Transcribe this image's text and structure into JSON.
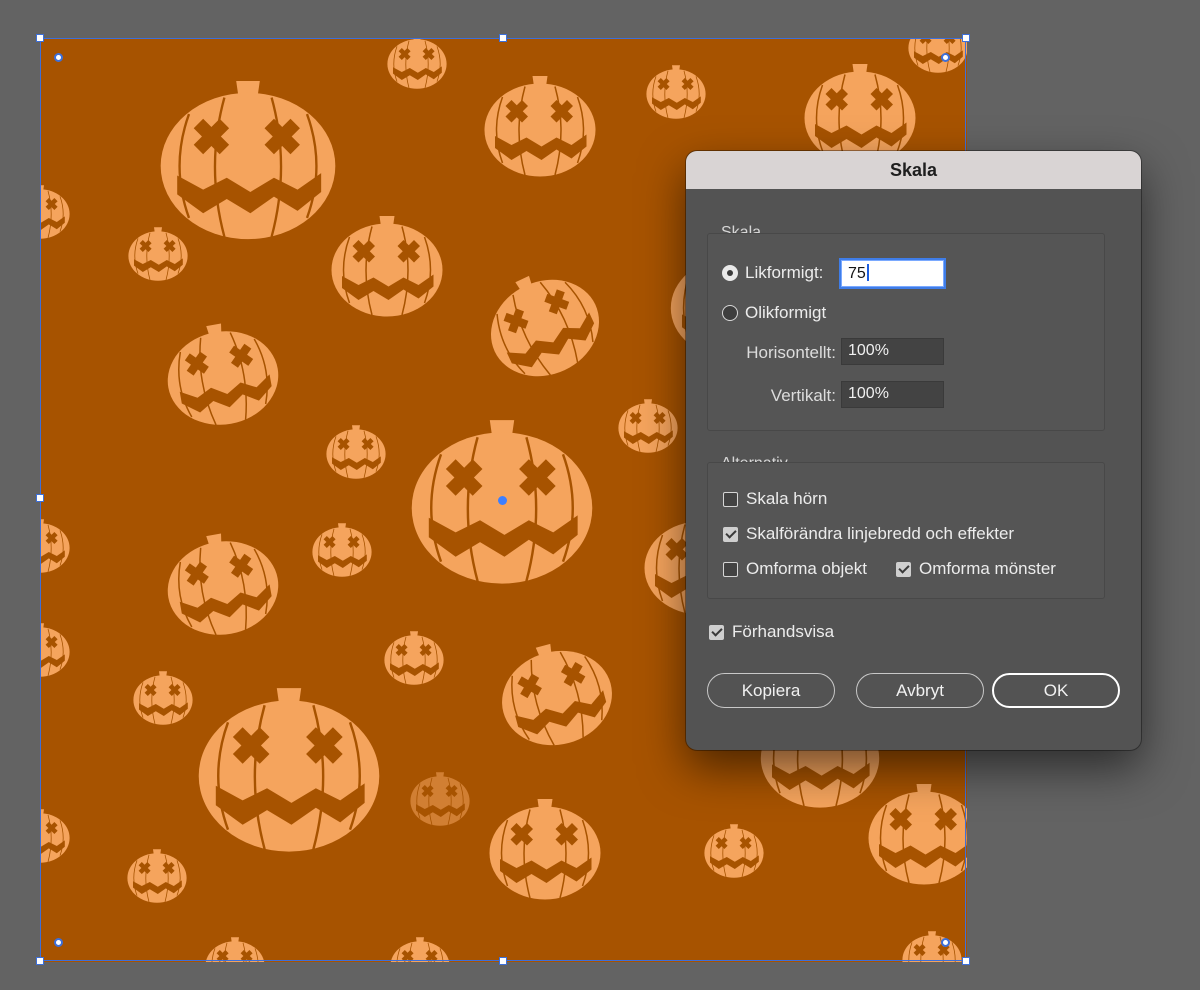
{
  "canvas": {
    "background": "#a75300",
    "pumpkin_color": "#f5a45d",
    "carve_color": "#a75300"
  },
  "dialog": {
    "title": "Skala",
    "scale_group": {
      "title": "Skala",
      "uniform_label": "Likformigt:",
      "uniform_value": "75",
      "non_uniform_label": "Olikformigt",
      "horizontal_label": "Horisontellt:",
      "horizontal_value": "100%",
      "vertical_label": "Vertikalt:",
      "vertical_value": "100%",
      "selected": "uniform"
    },
    "options_group": {
      "title": "Alternativ",
      "scale_corners": {
        "label": "Skala hörn",
        "checked": false
      },
      "scale_strokes": {
        "label": "Skalförändra linjebredd och effekter",
        "checked": true
      },
      "transform_objects": {
        "label": "Omforma objekt",
        "checked": false
      },
      "transform_patterns": {
        "label": "Omforma mönster",
        "checked": true
      }
    },
    "preview": {
      "label": "Förhandsvisa",
      "checked": true
    },
    "buttons": {
      "copy": "Kopiera",
      "cancel": "Avbryt",
      "ok": "OK"
    }
  }
}
